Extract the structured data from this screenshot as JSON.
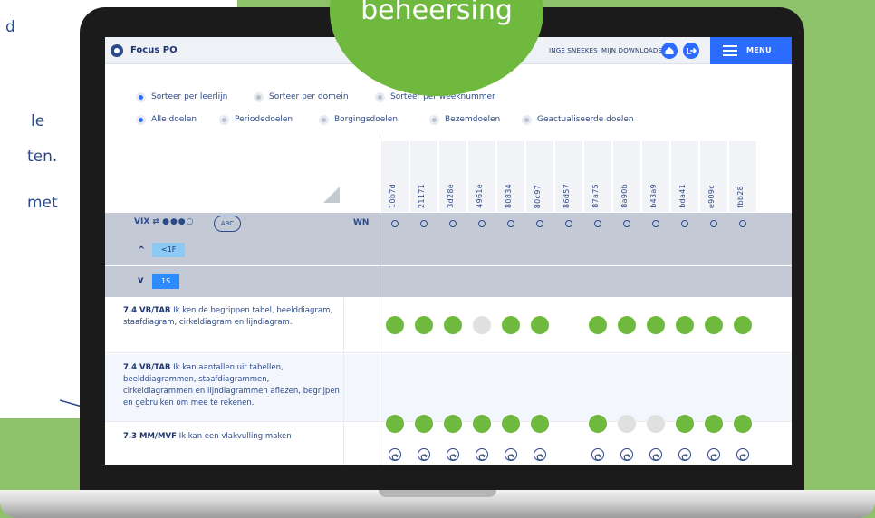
{
  "badge": {
    "text": "beheersing"
  },
  "left_text": [
    "d",
    "le",
    "ten.",
    "met"
  ],
  "app": {
    "title": "Focus PO"
  },
  "topbar": {
    "user": "INGE SNEEKES",
    "downloads": "MIJN DOWNLOADS",
    "menu_label": "MENU"
  },
  "icons": {
    "logo": "focus-logo-icon",
    "home": "home-icon",
    "exit": "logout-icon",
    "menu": "hamburger-icon",
    "arrow": "arrow-right-icon",
    "retry": "retry-icon"
  },
  "colors": {
    "accent": "#2b6cff",
    "achieved": "#6fb93f",
    "not_achieved": "#e0e0e0",
    "text": "#2c4a8a",
    "row_band": "#c3cad6"
  },
  "sort_options": [
    {
      "label": "Sorteer per leerlijn",
      "selected": true
    },
    {
      "label": "Sorteer per domein",
      "selected": false
    },
    {
      "label": "Sorteer per weeknummer",
      "selected": false
    }
  ],
  "goal_filters": [
    {
      "label": "Alle doelen",
      "selected": true
    },
    {
      "label": "Periodedoelen",
      "selected": false
    },
    {
      "label": "Borgingsdoelen",
      "selected": false
    },
    {
      "label": "Bezemdoelen",
      "selected": false
    },
    {
      "label": "Geactualiseerde doelen",
      "selected": false
    }
  ],
  "students": [
    "10b7d",
    "21171",
    "3d28e",
    "4961e",
    "80834",
    "80c97",
    "86d57",
    "87a75",
    "8a90b",
    "b43a9",
    "bda41",
    "e909c",
    "fbb28"
  ],
  "header_row": {
    "vix_label": "VIX",
    "vix_level": "●●●○",
    "abc_label": "ABC",
    "wn_label": "WN"
  },
  "levels": [
    {
      "chevron": "^",
      "label": "<1F"
    },
    {
      "chevron": "v",
      "label": "1S"
    }
  ],
  "goals": [
    {
      "code": "7.4 VB/TAB",
      "text": " Ik ken de begrippen tabel, beelddiagram, staafdiagram, cirkeldiagram en lijndiagram.",
      "status": [
        "g",
        "g",
        "g",
        "x",
        "g",
        "g",
        "",
        "g",
        "g",
        "g",
        "g",
        "g",
        "g"
      ]
    },
    {
      "code": "7.4 VB/TAB",
      "text": " Ik kan aantallen uit tabellen, beelddiagrammen, staafdiagrammen, cirkeldiagrammen en lijndiagrammen aflezen, begrijpen en gebruiken om mee te rekenen.",
      "status": [
        "g",
        "g",
        "g",
        "g",
        "g",
        "g",
        "",
        "g",
        "x",
        "x",
        "g",
        "g",
        "g"
      ]
    },
    {
      "code": "7.3 MM/MVF",
      "text": " Ik kan een vlakvulling maken",
      "status": [
        "r",
        "r",
        "r",
        "r",
        "r",
        "r",
        "",
        "r",
        "r",
        "r",
        "r",
        "r",
        "r"
      ]
    }
  ]
}
